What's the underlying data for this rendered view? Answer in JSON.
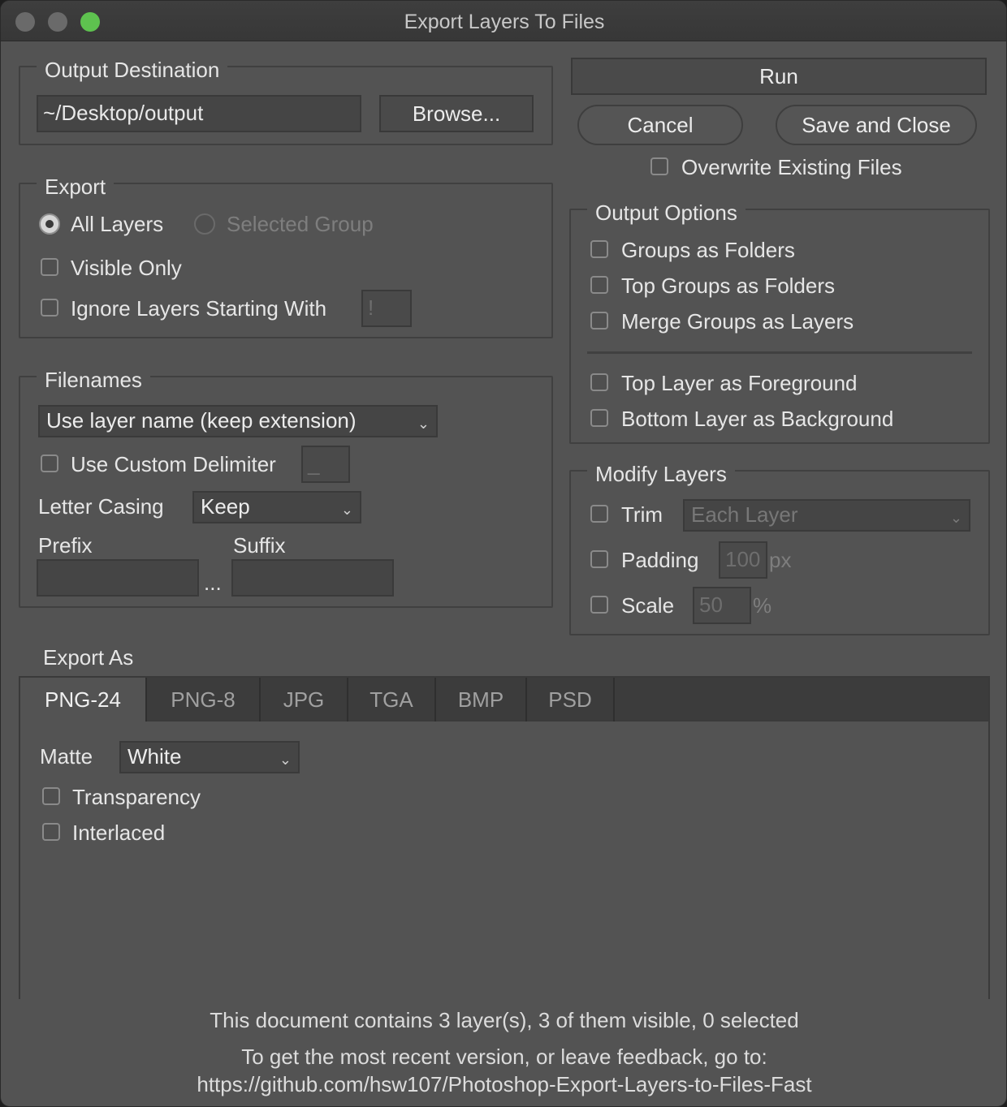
{
  "window": {
    "title": "Export Layers To Files"
  },
  "output_destination": {
    "label": "Output Destination",
    "path_value": "~/Desktop/output",
    "browse_label": "Browse..."
  },
  "actions": {
    "run_label": "Run",
    "cancel_label": "Cancel",
    "save_close_label": "Save and Close",
    "overwrite_label": "Overwrite Existing Files",
    "overwrite_checked": false
  },
  "export": {
    "label": "Export",
    "radio_all_layers": "All Layers",
    "radio_selected_group": "Selected Group",
    "selected": "All Layers",
    "visible_only": "Visible Only",
    "ignore_layers": "Ignore Layers Starting With",
    "ignore_prefix": "!"
  },
  "output_options": {
    "label": "Output Options",
    "groups_as_folders": "Groups as Folders",
    "top_groups_as_folders": "Top Groups as Folders",
    "merge_groups_as_layers": "Merge Groups as Layers",
    "top_layer_foreground": "Top Layer as Foreground",
    "bottom_layer_background": "Bottom Layer as Background"
  },
  "filenames": {
    "label": "Filenames",
    "naming_select": "Use layer name (keep extension)",
    "custom_delimiter": "Use Custom Delimiter",
    "delimiter_value": "_",
    "letter_casing_label": "Letter Casing",
    "letter_casing_value": "Keep",
    "prefix_label": "Prefix",
    "suffix_label": "Suffix",
    "prefix_value": "",
    "suffix_value": "",
    "ellipsis": "..."
  },
  "modify_layers": {
    "label": "Modify Layers",
    "trim_label": "Trim",
    "trim_select": "Each Layer",
    "padding_label": "Padding",
    "padding_value": "100",
    "padding_unit": "px",
    "scale_label": "Scale",
    "scale_value": "50",
    "scale_unit": "%"
  },
  "export_as": {
    "label": "Export As",
    "tabs": [
      "PNG-24",
      "PNG-8",
      "JPG",
      "TGA",
      "BMP",
      "PSD"
    ],
    "active_tab": "PNG-24",
    "matte_label": "Matte",
    "matte_value": "White",
    "transparency_label": "Transparency",
    "interlaced_label": "Interlaced"
  },
  "footer": {
    "status": "This document contains 3 layer(s), 3 of them visible, 0 selected",
    "feedback": "To get the most recent version, or leave feedback, go to:",
    "url": "https://github.com/hsw107/Photoshop-Export-Layers-to-Files-Fast"
  },
  "colors": {
    "background": "#535353",
    "titlebar": "#3a3a3a",
    "zoom_button": "#5ec24f"
  }
}
